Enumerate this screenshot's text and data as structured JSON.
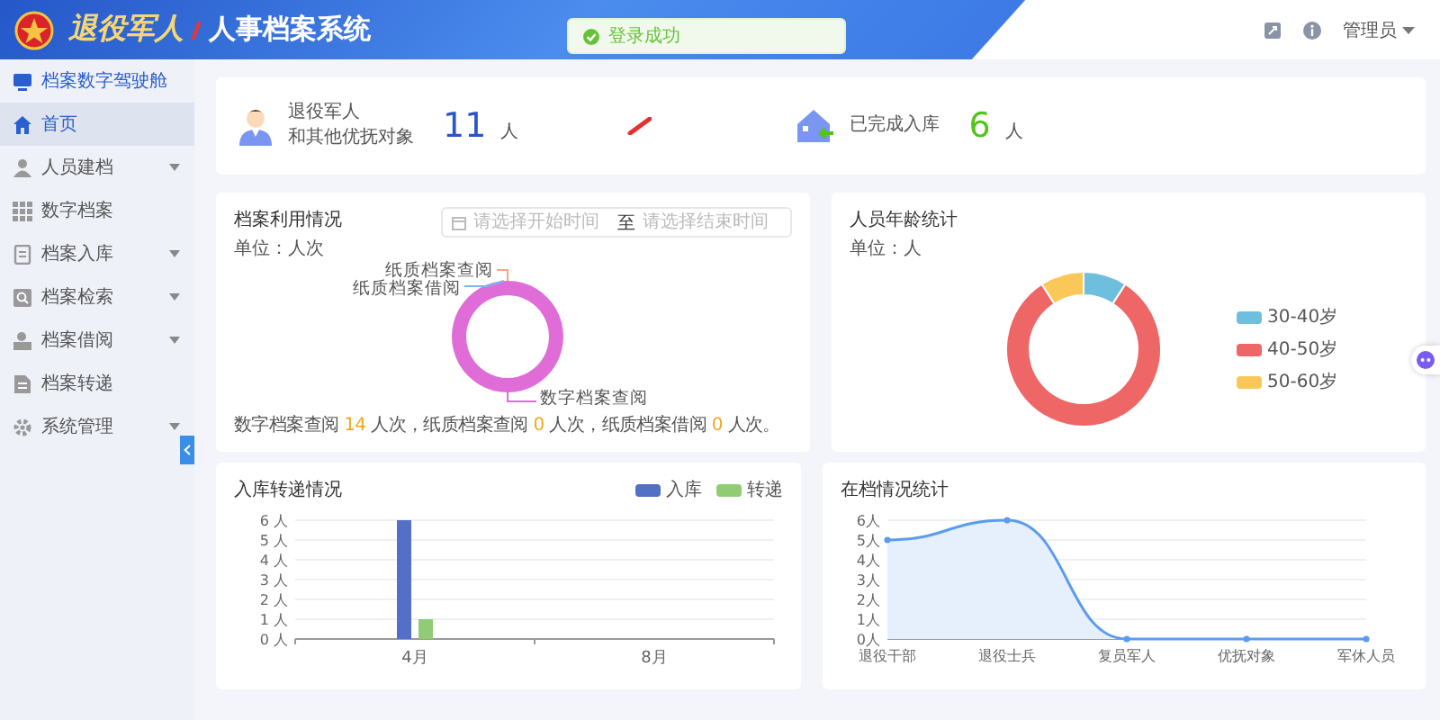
{
  "header": {
    "title_emblem": "退役军人",
    "title": "人事档案系统",
    "user": "管理员"
  },
  "toast": {
    "kind": "success",
    "text": "登录成功"
  },
  "sidebar": {
    "items": [
      {
        "label": "档案数字驾驶舱",
        "kind": "cockpit",
        "selected": false
      },
      {
        "label": "首页",
        "kind": "page",
        "selected": true
      },
      {
        "label": "人员建档",
        "kind": "group",
        "selected": false
      },
      {
        "label": "数字档案",
        "kind": "page",
        "selected": false
      },
      {
        "label": "档案入库",
        "kind": "group",
        "selected": false
      },
      {
        "label": "档案检索",
        "kind": "group",
        "selected": false
      },
      {
        "label": "档案借阅",
        "kind": "group",
        "selected": false
      },
      {
        "label": "档案转递",
        "kind": "page",
        "selected": false
      },
      {
        "label": "系统管理",
        "kind": "group",
        "selected": false
      }
    ]
  },
  "stats": [
    {
      "kind": "veterans",
      "label_lines": [
        "退役军人",
        "和其他优抚对象"
      ],
      "value": "11",
      "unit": "人"
    },
    {
      "kind": "stored",
      "label_lines": [
        "已完成入库"
      ],
      "value": "6",
      "unit": "人"
    }
  ],
  "usage_card": {
    "title": "档案利用情况",
    "unit": "单位：人次",
    "date_range": {
      "start_placeholder": "请选择开始时间",
      "separator": "至",
      "end_placeholder": "请选择结束时间"
    },
    "chart_data": {
      "type": "pie",
      "categories": [
        "数字档案查阅",
        "纸质档案查阅",
        "纸质档案借阅"
      ],
      "values": [
        100,
        0,
        0
      ]
    },
    "summary": [
      {
        "kind": "text",
        "text": "数字档案查阅 "
      },
      {
        "kind": "count",
        "text": "14"
      },
      {
        "kind": "text",
        "text": " 人次，纸质档案查阅 "
      },
      {
        "kind": "count",
        "text": "0"
      },
      {
        "kind": "text",
        "text": " 人次，纸质档案借阅 "
      },
      {
        "kind": "count",
        "text": "0"
      },
      {
        "kind": "text",
        "text": " 人次。"
      }
    ]
  },
  "age_card": {
    "title": "人员年龄统计",
    "unit": "单位：人",
    "legend": [
      {
        "label": "30-40岁",
        "color": "#6ebee0"
      },
      {
        "label": "40-50岁",
        "color": "#ee6666"
      },
      {
        "label": "50-60岁",
        "color": "#fac858"
      }
    ]
  },
  "transfer_card": {
    "title": "入库转递情况",
    "chart_data": {
      "type": "bar",
      "categories": [
        "4月",
        "8月"
      ],
      "series": [
        {
          "name": "入库",
          "color": "#5470c6",
          "values": [
            6,
            0
          ]
        },
        {
          "name": "转递",
          "color": "#91cc75",
          "values": [
            1,
            0
          ]
        }
      ],
      "ylim": [
        0,
        6
      ],
      "grid": true,
      "yticks": [
        {
          "value": 0,
          "label": "0 人"
        },
        {
          "value": 1,
          "label": "1 人"
        },
        {
          "value": 2,
          "label": "2 人"
        },
        {
          "value": 3,
          "label": "3 人"
        },
        {
          "value": 4,
          "label": "4 人"
        },
        {
          "value": 5,
          "label": "5 人"
        },
        {
          "value": 6,
          "label": "6 人"
        }
      ]
    }
  },
  "archive_card": {
    "title": "在档情况统计",
    "chart_data": {
      "type": "area",
      "categories": [
        "退役干部",
        "退役士兵",
        "复员军人",
        "优抚对象",
        "军休人员"
      ],
      "series": [
        {
          "color": "#5b9bf0",
          "values": [
            5,
            6,
            0,
            0,
            0
          ]
        }
      ],
      "ylim": [
        0,
        6
      ],
      "grid": true,
      "yticks": [
        {
          "value": 0,
          "label": "0人"
        },
        {
          "value": 1,
          "label": "1人"
        },
        {
          "value": 2,
          "label": "2人"
        },
        {
          "value": 3,
          "label": "3人"
        },
        {
          "value": 4,
          "label": "4人"
        },
        {
          "value": 5,
          "label": "5人"
        },
        {
          "value": 6,
          "label": "6人"
        }
      ]
    }
  }
}
